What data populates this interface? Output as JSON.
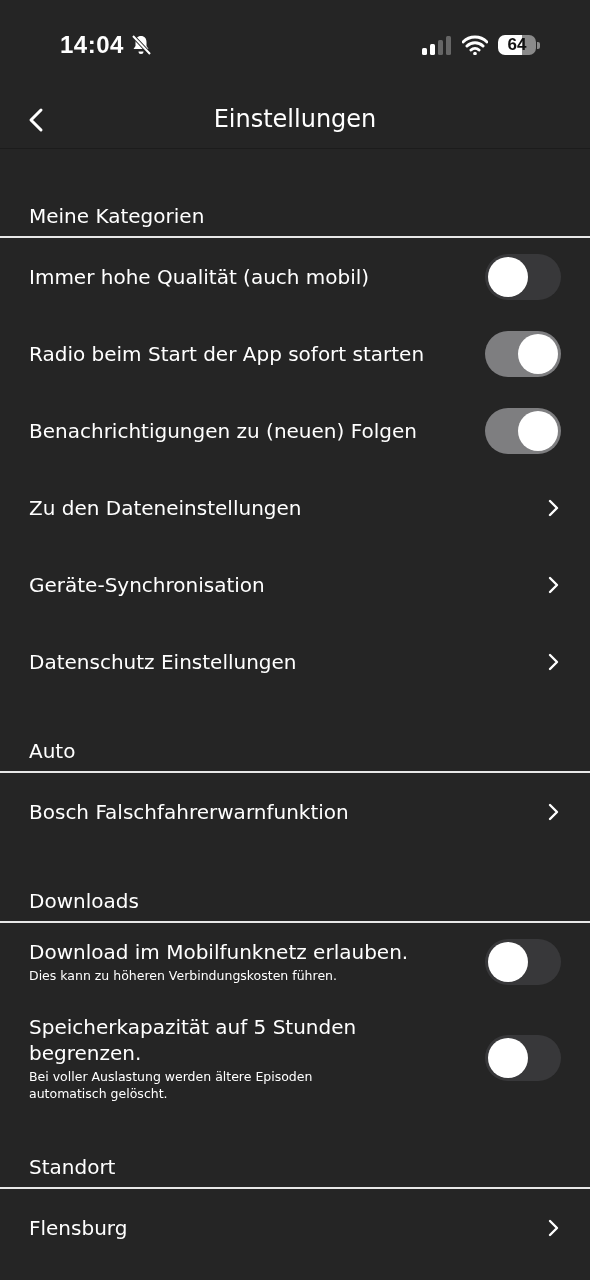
{
  "status_bar": {
    "time": "14:04",
    "battery": "64"
  },
  "header": {
    "title": "Einstellungen"
  },
  "sections": [
    {
      "title": "Meine Kategorien",
      "items": [
        {
          "kind": "toggle",
          "label": "Immer hohe Qualität (auch mobil)",
          "on": false
        },
        {
          "kind": "toggle",
          "label": "Radio beim Start der App sofort starten",
          "on": true
        },
        {
          "kind": "toggle",
          "label": "Benachrichtigungen zu (neuen) Folgen",
          "on": true
        },
        {
          "kind": "link",
          "label": "Zu den Dateneinstellungen"
        },
        {
          "kind": "link",
          "label": "Geräte-Synchronisation"
        },
        {
          "kind": "link",
          "label": "Datenschutz Einstellungen"
        }
      ]
    },
    {
      "title": "Auto",
      "items": [
        {
          "kind": "link",
          "label": "Bosch Falschfahrerwarnfunktion"
        }
      ]
    },
    {
      "title": "Downloads",
      "items": [
        {
          "kind": "toggle",
          "label": "Download im Mobilfunknetz erlauben.",
          "subtitle": "Dies kann zu höheren Verbindungskosten führen.",
          "on": false
        },
        {
          "kind": "toggle",
          "label": "Speicherkapazität auf 5 Stunden begrenzen.",
          "subtitle": "Bei voller Auslastung werden ältere Episoden automatisch gelöscht.",
          "on": false
        }
      ]
    },
    {
      "title": "Standort",
      "items": [
        {
          "kind": "link",
          "label": "Flensburg"
        }
      ]
    }
  ]
}
